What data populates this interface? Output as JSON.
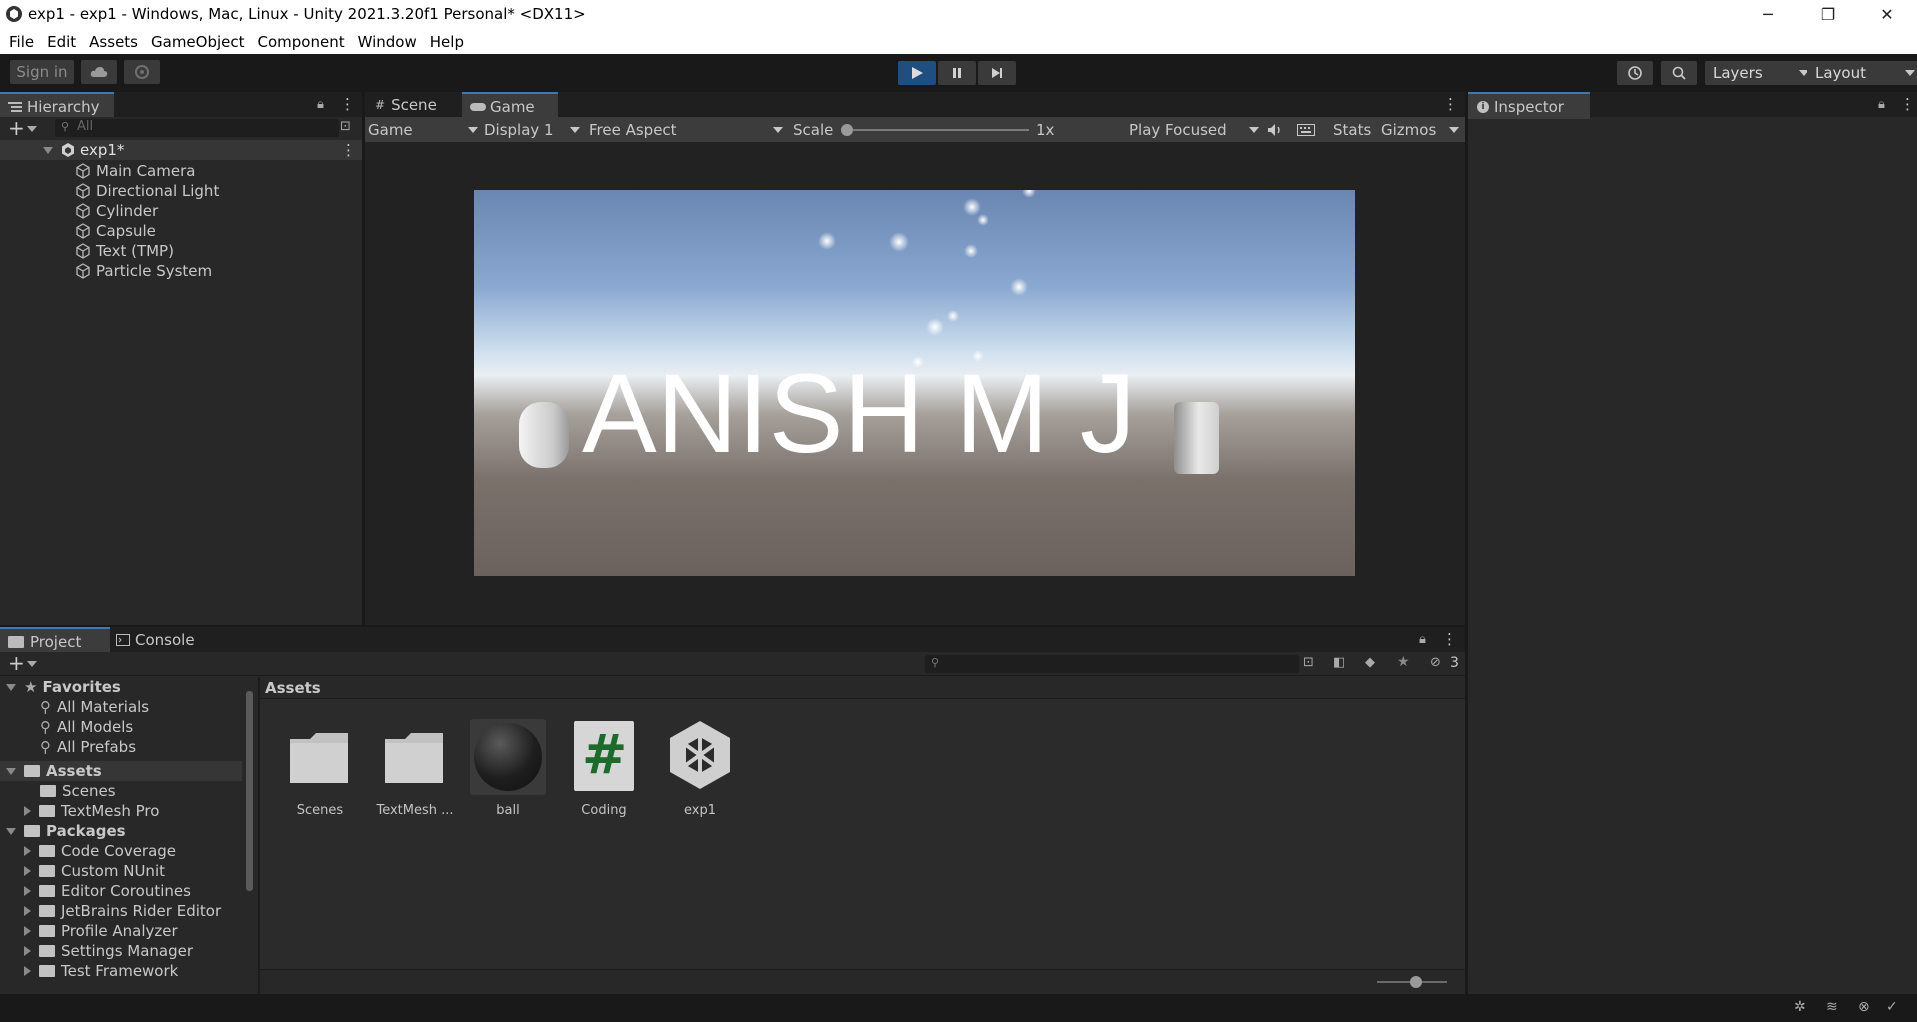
{
  "window": {
    "title": "exp1 - exp1 - Windows, Mac, Linux - Unity 2021.3.20f1 Personal* <DX11>",
    "minimize_glyph": "─",
    "restore_glyph": "❐",
    "close_glyph": "✕"
  },
  "menu": [
    "File",
    "Edit",
    "Assets",
    "GameObject",
    "Component",
    "Window",
    "Help"
  ],
  "toolbar": {
    "sign_in": "Sign in",
    "layers": "Layers",
    "layout": "Layout"
  },
  "hierarchy": {
    "title": "Hierarchy",
    "search_placeholder": "All",
    "scene": "exp1*",
    "items": [
      "Main Camera",
      "Directional Light",
      "Cylinder",
      "Capsule",
      "Text (TMP)",
      "Particle System"
    ]
  },
  "game_view": {
    "tabs": [
      "Scene",
      "Game"
    ],
    "mode": "Game",
    "display": "Display 1",
    "aspect": "Free Aspect",
    "scale_label": "Scale",
    "scale_value": "1x",
    "play_mode": "Play Focused",
    "stats": "Stats",
    "gizmos": "Gizmos",
    "rendered_text": "ANISH M J",
    "sky_top": "#6f8bb5",
    "ground": "#6b625e"
  },
  "inspector": {
    "title": "Inspector"
  },
  "project": {
    "tabs": [
      "Project",
      "Console"
    ],
    "favorites_label": "Favorites",
    "favorites": [
      "All Materials",
      "All Models",
      "All Prefabs"
    ],
    "assets_label": "Assets",
    "assets_tree": [
      "Scenes",
      "TextMesh Pro"
    ],
    "packages_label": "Packages",
    "packages": [
      "Code Coverage",
      "Custom NUnit",
      "Editor Coroutines",
      "JetBrains Rider Editor",
      "Profile Analyzer",
      "Settings Manager",
      "Test Framework"
    ],
    "breadcrumb": "Assets",
    "hidden_count": "3",
    "items": [
      {
        "label": "Scenes",
        "kind": "folder"
      },
      {
        "label": "TextMesh ...",
        "kind": "folder"
      },
      {
        "label": "ball",
        "kind": "material"
      },
      {
        "label": "Coding",
        "kind": "script"
      },
      {
        "label": "exp1",
        "kind": "unity-scene"
      }
    ]
  },
  "colors": {
    "accent": "#3a79bb",
    "play_active": "#1e4f80"
  }
}
